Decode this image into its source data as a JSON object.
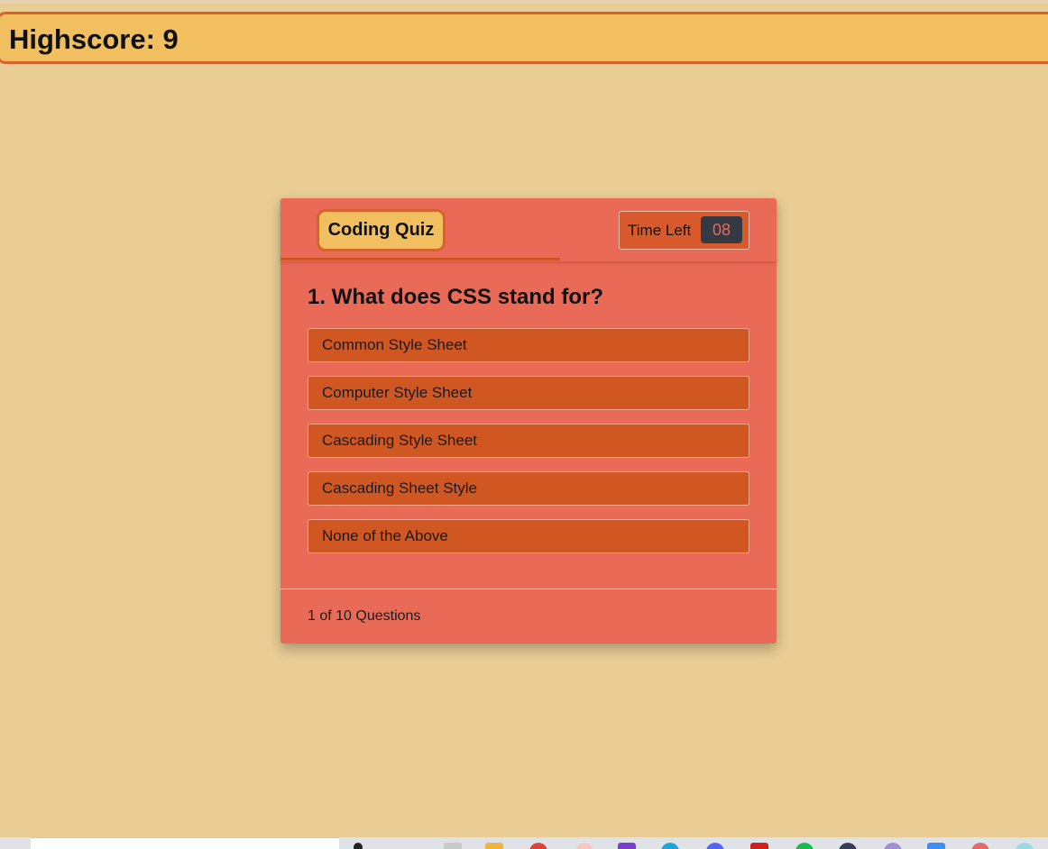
{
  "header": {
    "highscore_label": "Highscore:",
    "highscore_value": "9"
  },
  "quiz": {
    "title": "Coding Quiz",
    "timer_label": "Time Left",
    "timer_value": "08",
    "question_number": "1.",
    "question_text": "What does CSS stand for?",
    "options": [
      "Common Style Sheet",
      "Computer Style Sheet",
      "Cascading Style Sheet",
      "Cascading Sheet Style",
      "None of the Above"
    ],
    "progress_text": "1 of 10 Questions"
  },
  "taskbar": {
    "icons": [
      "search-box",
      "task-view-icon",
      "file-explorer-icon",
      "folder-icon",
      "chrome-icon",
      "app-icon",
      "app-icon",
      "app-icon",
      "app-icon",
      "app-icon",
      "app-icon",
      "app-icon",
      "app-icon",
      "app-icon",
      "app-icon"
    ]
  },
  "colors": {
    "page_background": "#e9cd95",
    "highscore_bar": "#f1bf60",
    "accent_border": "#d6632c",
    "card_background": "#e96a57",
    "option_background": "#d05722",
    "timer_badge": "#333a44"
  }
}
